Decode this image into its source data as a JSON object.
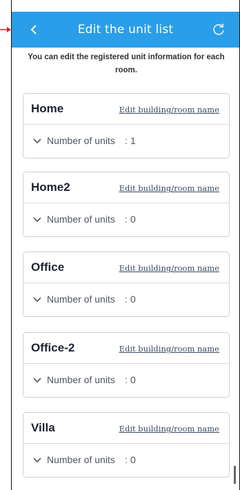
{
  "header": {
    "title": "Edit the unit list",
    "back_icon": "chevron-left-icon",
    "refresh_icon": "refresh-icon",
    "color": "#2a9ee8"
  },
  "notice": "You can edit the registered unit information for each room.",
  "cards": [
    {
      "name": "Home",
      "edit_label": "Edit building/room name",
      "units_label": "Number of units",
      "units_sep": ":",
      "units": "1"
    },
    {
      "name": "Home2",
      "edit_label": "Edit building/room name",
      "units_label": "Number of units",
      "units_sep": ":",
      "units": "0"
    },
    {
      "name": "Office",
      "edit_label": "Edit building/room name",
      "units_label": "Number of units",
      "units_sep": ":",
      "units": "0"
    },
    {
      "name": "Office-2",
      "edit_label": "Edit building/room name",
      "units_label": "Number of units",
      "units_sep": ":",
      "units": "0"
    },
    {
      "name": "Villa",
      "edit_label": "Edit building/room name",
      "units_label": "Number of units",
      "units_sep": ":",
      "units": "0"
    }
  ]
}
